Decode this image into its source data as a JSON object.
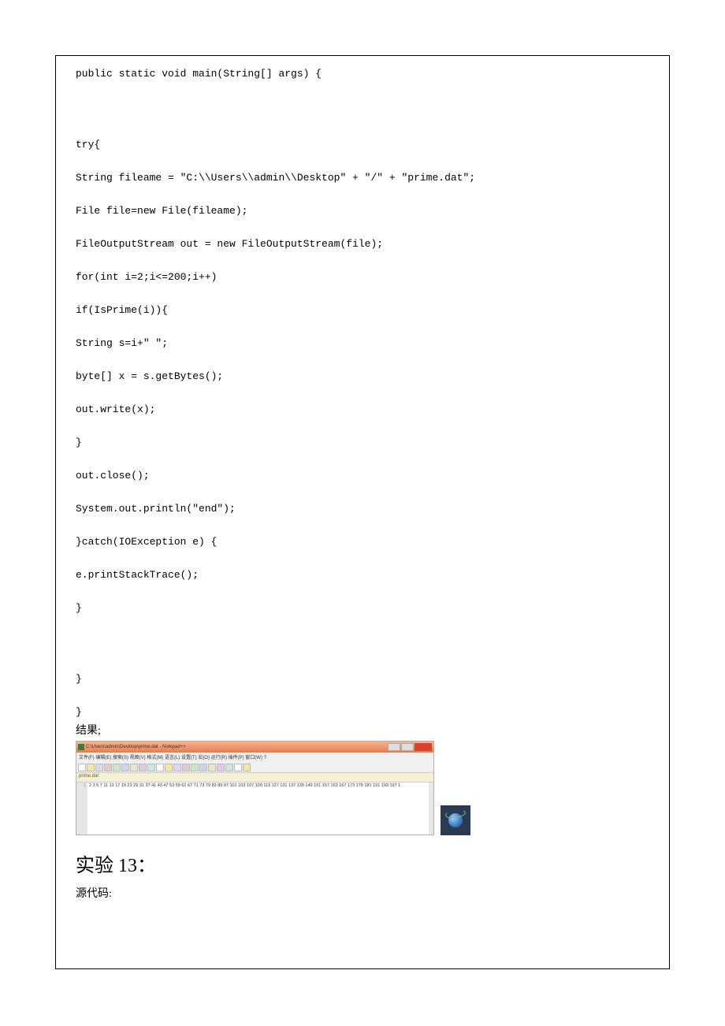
{
  "code": {
    "l1": "    public static void main(String[] args) {",
    "l2": "    try{",
    "l3": "         String fileame = \"C:\\\\Users\\\\admin\\\\Desktop\" + \"/\" + \"prime.dat\";",
    "l4": "         File file=new File(fileame);",
    "l5": "         FileOutputStream out = new FileOutputStream(file);",
    "l6": "         for(int i=2;i<=200;i++)",
    "l7": "              if(IsPrime(i)){",
    "l8": "                   String s=i+\" \";",
    "l9": "                   byte[] x = s.getBytes();",
    "l10": "                   out.write(x);",
    "l11": "              }",
    "l12": "         out.close();",
    "l13": "         System.out.println(\"end\");",
    "l14": "    }catch(IOException e) {",
    "l15": "         e.printStackTrace();",
    "l16": "    }",
    "l17": "    }",
    "l18": "}"
  },
  "result_label": "结果;",
  "notepad": {
    "title": "C:\\Users\\admin\\Desktop\\prime.dat - Notepad++",
    "menu": "文件(F) 编辑(E) 搜索(S) 视图(V) 格式(M) 语言(L) 设置(T) 宏(O) 运行(R) 插件(P) 窗口(W) ?",
    "tab": "prime.dat",
    "content_line": "2 3 5 7 11 13 17 19 23 29 31 37 41 43 47 53 59 61 67 71 73 79 83 89 97 101 103 107 109 113 127 131 137 139 149 151 157 163 167 173 179 181 191 193 197 1",
    "gutter_1": "1"
  },
  "heading": {
    "prefix": "实验 ",
    "num": "13",
    "suffix": "："
  },
  "source_label": "源代码:"
}
